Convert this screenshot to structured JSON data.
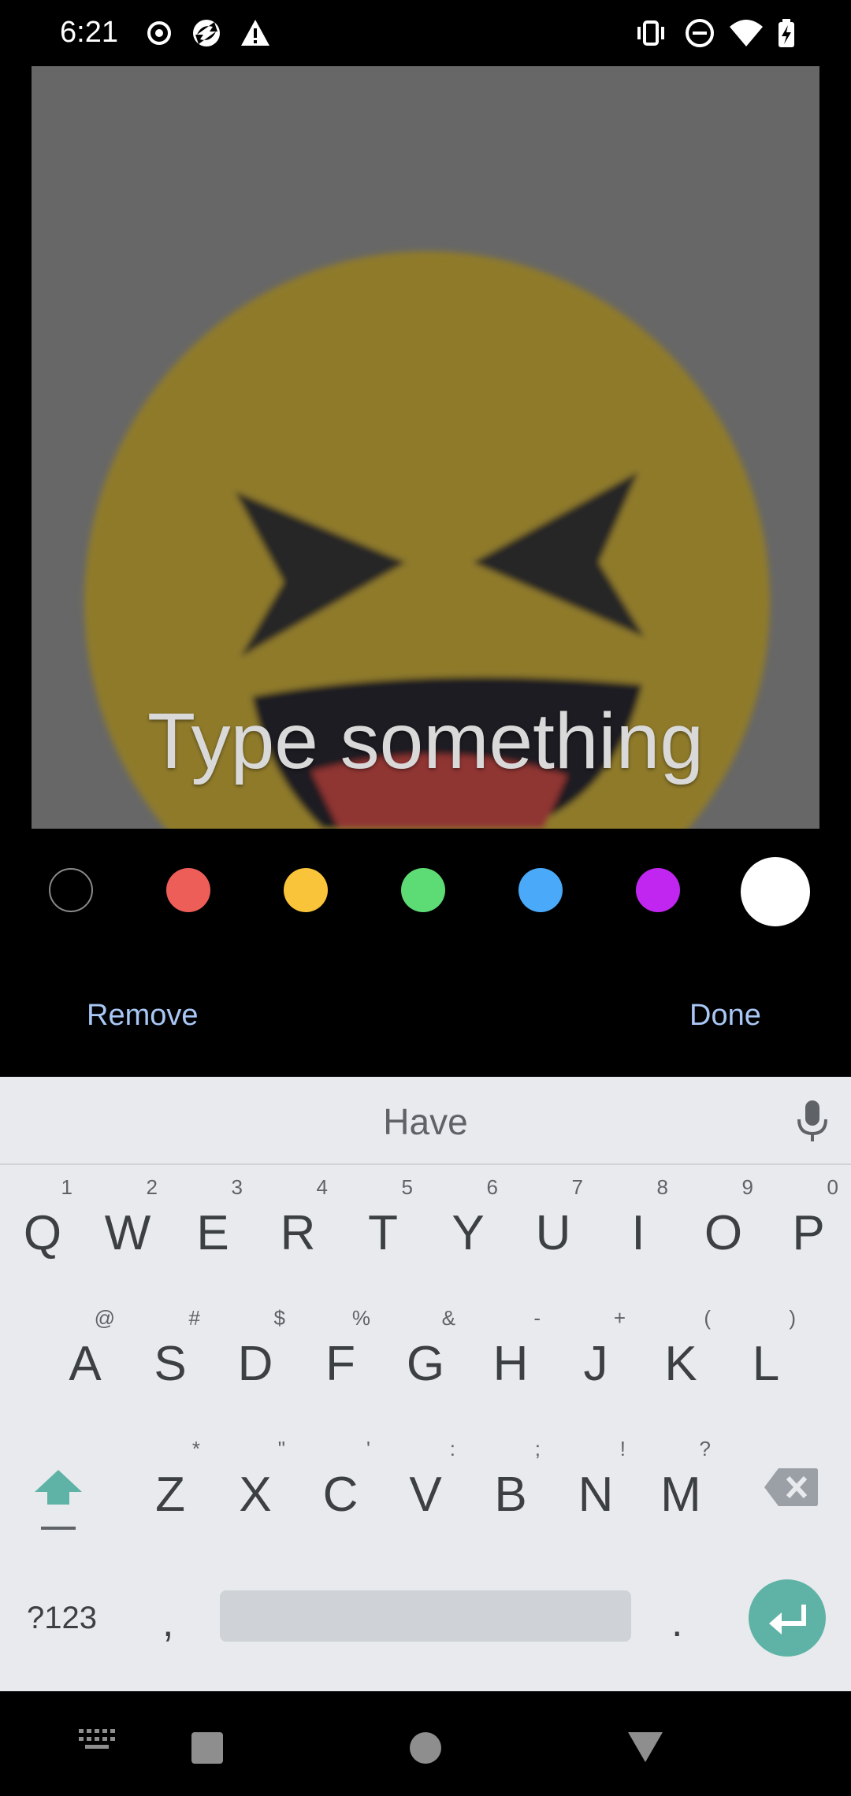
{
  "status_bar": {
    "time": "6:21",
    "icons_left": [
      "record-icon",
      "sync-icon",
      "alert-icon"
    ],
    "icons_right": [
      "vibrate-icon",
      "do-not-disturb-icon",
      "wifi-icon",
      "battery-charging-icon"
    ]
  },
  "editor": {
    "text_overlay": "Type something",
    "colors": [
      "#000000",
      "#ee5e58",
      "#f9c33a",
      "#5ddc75",
      "#4aa9f8",
      "#c026ef",
      "#ffffff"
    ],
    "selected_color": "#ffffff"
  },
  "actions": {
    "remove_label": "Remove",
    "done_label": "Done"
  },
  "keyboard": {
    "suggestion": "Have",
    "row1": [
      {
        "key": "Q",
        "hint": "1"
      },
      {
        "key": "W",
        "hint": "2"
      },
      {
        "key": "E",
        "hint": "3"
      },
      {
        "key": "R",
        "hint": "4"
      },
      {
        "key": "T",
        "hint": "5"
      },
      {
        "key": "Y",
        "hint": "6"
      },
      {
        "key": "U",
        "hint": "7"
      },
      {
        "key": "I",
        "hint": "8"
      },
      {
        "key": "O",
        "hint": "9"
      },
      {
        "key": "P",
        "hint": "0"
      }
    ],
    "row2": [
      {
        "key": "A",
        "hint": "@"
      },
      {
        "key": "S",
        "hint": "#"
      },
      {
        "key": "D",
        "hint": "$"
      },
      {
        "key": "F",
        "hint": "%"
      },
      {
        "key": "G",
        "hint": "&"
      },
      {
        "key": "H",
        "hint": "-"
      },
      {
        "key": "J",
        "hint": "+"
      },
      {
        "key": "K",
        "hint": "("
      },
      {
        "key": "L",
        "hint": ")"
      }
    ],
    "row3": [
      {
        "key": "Z",
        "hint": "*"
      },
      {
        "key": "X",
        "hint": "\""
      },
      {
        "key": "C",
        "hint": "'"
      },
      {
        "key": "V",
        "hint": ":"
      },
      {
        "key": "B",
        "hint": ";"
      },
      {
        "key": "N",
        "hint": "!"
      },
      {
        "key": "M",
        "hint": "?"
      }
    ],
    "symbols_label": "?123",
    "comma": ",",
    "period": "."
  },
  "nav_bar": {
    "icons": [
      "keyboard-switch-icon",
      "recents-icon",
      "home-icon",
      "back-icon"
    ]
  }
}
